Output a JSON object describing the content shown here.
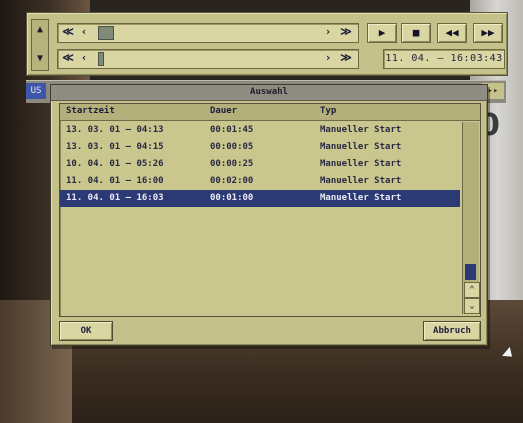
{
  "controls": {
    "scroll_up": "▲",
    "scroll_down": "▼",
    "rewind_fast": "≪",
    "rewind": "‹",
    "forward": "›",
    "forward_fast": "≫",
    "play": "▶",
    "stop": "■",
    "skip_back": "◀◀",
    "skip_fwd": "▶▶",
    "date_range": "11. 04. – 16:03:43"
  },
  "dialog": {
    "title": "Auswahl",
    "columns": [
      "Startzeit",
      "Dauer",
      "Typ"
    ],
    "rows": [
      {
        "start": "13. 03. 01 – 04:13",
        "duration": "00:01:45",
        "type": "Manueller Start"
      },
      {
        "start": "13. 03. 01 – 04:15",
        "duration": "00:00:05",
        "type": "Manueller Start"
      },
      {
        "start": "10. 04. 01 – 05:26",
        "duration": "00:00:25",
        "type": "Manueller Start"
      },
      {
        "start": "11. 04. 01 – 16:00",
        "duration": "00:02:00",
        "type": "Manueller Start"
      },
      {
        "start": "11. 04. 01 – 16:03",
        "duration": "00:01:00",
        "type": "Manueller Start"
      }
    ],
    "selected_index": 4,
    "ok_label": "OK",
    "cancel_label": "Abbruch",
    "scroll_up": "⌃",
    "scroll_down": "⌄"
  },
  "strip": {
    "left_tab": "US",
    "right_tab": "▸▸"
  },
  "scene": {
    "digit": "0"
  }
}
